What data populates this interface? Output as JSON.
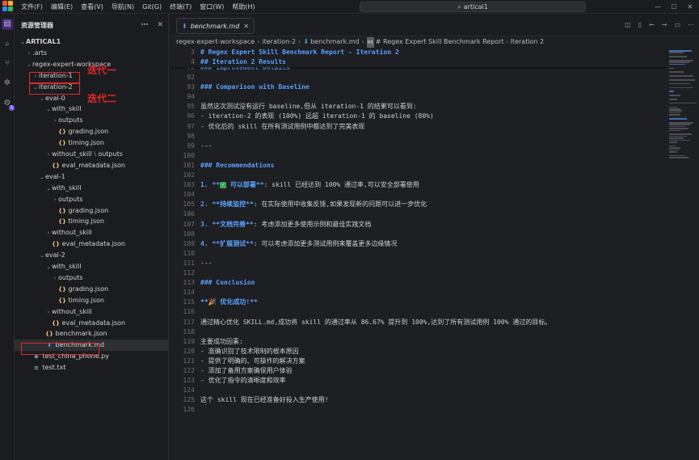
{
  "titlebar": {
    "menus": [
      "文件(F)",
      "编辑(E)",
      "查看(V)",
      "导航(N)",
      "Git(G)",
      "终端(T)",
      "窗口(W)",
      "帮助(H)"
    ],
    "search_text": "artical1"
  },
  "sidebar": {
    "title": "资源管理器",
    "tree": [
      {
        "label": "ARTICAL1",
        "depth": 0,
        "chev": "⌄",
        "type": "root"
      },
      {
        "label": ".arts",
        "depth": 1,
        "chev": "›",
        "type": "folder"
      },
      {
        "label": "regex-expert-workspace",
        "depth": 1,
        "chev": "⌄",
        "type": "folder"
      },
      {
        "label": "iteration-1",
        "depth": 2,
        "chev": "›",
        "type": "folder"
      },
      {
        "label": "iteration-2",
        "depth": 2,
        "chev": "⌄",
        "type": "folder"
      },
      {
        "label": "eval-0",
        "depth": 3,
        "chev": "⌄",
        "type": "folder"
      },
      {
        "label": "with_skill",
        "depth": 4,
        "chev": "⌄",
        "type": "folder"
      },
      {
        "label": "outputs",
        "depth": 5,
        "chev": "›",
        "type": "folder"
      },
      {
        "label": "grading.json",
        "depth": 5,
        "chev": "",
        "type": "json"
      },
      {
        "label": "timing.json",
        "depth": 5,
        "chev": "",
        "type": "json"
      },
      {
        "label": "without_skill",
        "depth": 4,
        "chev": "›",
        "type": "folder",
        "suffix": "outputs"
      },
      {
        "label": "eval_metadata.json",
        "depth": 4,
        "chev": "",
        "type": "json"
      },
      {
        "label": "eval-1",
        "depth": 3,
        "chev": "⌄",
        "type": "folder"
      },
      {
        "label": "with_skill",
        "depth": 4,
        "chev": "⌄",
        "type": "folder"
      },
      {
        "label": "outputs",
        "depth": 5,
        "chev": "›",
        "type": "folder"
      },
      {
        "label": "grading.json",
        "depth": 5,
        "chev": "",
        "type": "json"
      },
      {
        "label": "timing.json",
        "depth": 5,
        "chev": "",
        "type": "json"
      },
      {
        "label": "without_skill",
        "depth": 4,
        "chev": "›",
        "type": "folder"
      },
      {
        "label": "eval_metadata.json",
        "depth": 4,
        "chev": "",
        "type": "json"
      },
      {
        "label": "eval-2",
        "depth": 3,
        "chev": "⌄",
        "type": "folder"
      },
      {
        "label": "with_skill",
        "depth": 4,
        "chev": "⌄",
        "type": "folder"
      },
      {
        "label": "outputs",
        "depth": 5,
        "chev": "›",
        "type": "folder"
      },
      {
        "label": "grading.json",
        "depth": 5,
        "chev": "",
        "type": "json"
      },
      {
        "label": "timing.json",
        "depth": 5,
        "chev": "",
        "type": "json"
      },
      {
        "label": "without_skill",
        "depth": 4,
        "chev": "›",
        "type": "folder"
      },
      {
        "label": "eval_metadata.json",
        "depth": 4,
        "chev": "",
        "type": "json"
      },
      {
        "label": "benchmark.json",
        "depth": 3,
        "chev": "",
        "type": "json"
      },
      {
        "label": "benchmark.md",
        "depth": 3,
        "chev": "",
        "type": "md",
        "selected": true
      },
      {
        "label": "test_china_phone.py",
        "depth": 1,
        "chev": "",
        "type": "py"
      },
      {
        "label": "test.txt",
        "depth": 1,
        "chev": "",
        "type": "txt"
      }
    ]
  },
  "annotations": {
    "iter1": "迭代一",
    "iter2": "迭代二"
  },
  "editor": {
    "tab_label": "benchmark.md",
    "breadcrumb": [
      "regex-expert-workspace",
      "iteration-2",
      "benchmark.md",
      "# Regex Expert Skill Benchmark Report - Iteration 2"
    ],
    "sticky_lines": [
      {
        "n": "3",
        "t": "# Regex Expert Skill Benchmark Report - Iteration 2",
        "k": "heading"
      },
      {
        "n": "4",
        "t": "## Iteration 2 Results",
        "k": "heading"
      }
    ],
    "lines": [
      {
        "n": "92",
        "t": "",
        "k": "plain"
      },
      {
        "n": "93",
        "t": "### Comparison with Baseline",
        "k": "heading"
      },
      {
        "n": "94",
        "t": "",
        "k": "plain"
      },
      {
        "n": "95",
        "t": "虽然这次测试没有运行 baseline,但从 iteration-1 的结果可以看到:",
        "k": "plain"
      },
      {
        "n": "96",
        "t": "- iteration-2 的表现 (100%) 远超 iteration-1 的 baseline (80%)",
        "k": "plain"
      },
      {
        "n": "97",
        "t": "- 优化后的 skill 在所有测试用例中都达到了完美表现",
        "k": "plain"
      },
      {
        "n": "98",
        "t": "",
        "k": "plain"
      },
      {
        "n": "99",
        "t": "---",
        "k": "plain"
      },
      {
        "n": "100",
        "t": "",
        "k": "plain"
      },
      {
        "n": "101",
        "t": "### Recommendations",
        "k": "heading"
      },
      {
        "n": "102",
        "t": "",
        "k": "plain"
      },
      {
        "n": "103",
        "t": "1. **",
        "k": "rec",
        "b": " 可以部署**",
        "r": ": skill 已经达到 100% 通过率,可以安全部署使用",
        "check": true
      },
      {
        "n": "104",
        "t": "",
        "k": "plain"
      },
      {
        "n": "105",
        "t": "2. ",
        "k": "rec",
        "b": "**持续监控**",
        "r": ": 在实际使用中收集反馈,如果发现新的问题可以进一步优化"
      },
      {
        "n": "106",
        "t": "",
        "k": "plain"
      },
      {
        "n": "107",
        "t": "3. ",
        "k": "rec",
        "b": "**文档完善**",
        "r": ": 考虑添加更多使用示例和最佳实践文档"
      },
      {
        "n": "108",
        "t": "",
        "k": "plain"
      },
      {
        "n": "109",
        "t": "4. ",
        "k": "rec",
        "b": "**扩展测试**",
        "r": ": 可以考虑添加更多测试用例来覆盖更多边缘情况"
      },
      {
        "n": "110",
        "t": "",
        "k": "plain"
      },
      {
        "n": "111",
        "t": "---",
        "k": "plain"
      },
      {
        "n": "112",
        "t": "",
        "k": "plain"
      },
      {
        "n": "113",
        "t": "### Conclusion",
        "k": "heading"
      },
      {
        "n": "114",
        "t": "",
        "k": "plain"
      },
      {
        "n": "115",
        "t": "**🎉 优化成功!**",
        "k": "boldline"
      },
      {
        "n": "116",
        "t": "",
        "k": "plain"
      },
      {
        "n": "117",
        "t": "通过精心优化 SKILL.md,成功将 skill 的通过率从 86.67% 提升到 100%,达到了所有测试用例 100% 通过的目标。",
        "k": "plain"
      },
      {
        "n": "118",
        "t": "",
        "k": "plain"
      },
      {
        "n": "119",
        "t": "主要成功因素:",
        "k": "plain"
      },
      {
        "n": "120",
        "t": "- 准确识别了技术限制的根本原因",
        "k": "plain"
      },
      {
        "n": "121",
        "t": "- 提供了明确的、可操作的解决方案",
        "k": "plain"
      },
      {
        "n": "122",
        "t": "- 添加了备用方案确保用户体验",
        "k": "plain"
      },
      {
        "n": "123",
        "t": "- 优化了指令的清晰度和效率",
        "k": "plain"
      },
      {
        "n": "124",
        "t": "",
        "k": "plain"
      },
      {
        "n": "125",
        "t": "这个 skill 现在已经准备好投入生产使用!",
        "k": "plain"
      },
      {
        "n": "126",
        "t": "",
        "k": "plain"
      }
    ],
    "hidden_line": {
      "n": "72",
      "t": "### Improvement Details"
    }
  }
}
